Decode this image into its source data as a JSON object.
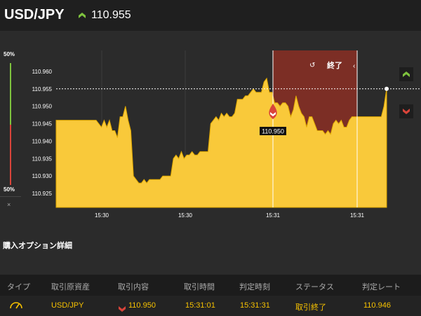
{
  "header": {
    "pair": "USD/JPY",
    "rate": "110.955",
    "rate_direction": "up",
    "up_color": "#7ec23e"
  },
  "sidebar": {
    "top_percent": "50%",
    "bottom_percent": "50%",
    "close_symbol": "×"
  },
  "chart_data": {
    "type": "area",
    "y_ticks": [
      "110.960",
      "110.955",
      "110.950",
      "110.945",
      "110.940",
      "110.935",
      "110.930",
      "110.925"
    ],
    "x_ticks": [
      "15:30",
      "15:30",
      "15:31",
      "15:31"
    ],
    "ylim": [
      110.921,
      110.966
    ],
    "current_rate": 110.955,
    "entry_marker_label": "110.950",
    "expiry_label": "終了",
    "fill_color": "#f9c93a",
    "line_color": "#e0a800",
    "expiry_zone_color": "#8b2f25",
    "values": [
      110.946,
      110.946,
      110.946,
      110.946,
      110.946,
      110.946,
      110.946,
      110.946,
      110.946,
      110.946,
      110.946,
      110.946,
      110.946,
      110.946,
      110.946,
      110.946,
      110.945,
      110.944,
      110.946,
      110.944,
      110.946,
      110.943,
      110.943,
      110.941,
      110.947,
      110.947,
      110.95,
      110.946,
      110.943,
      110.93,
      110.929,
      110.928,
      110.928,
      110.929,
      110.928,
      110.929,
      110.929,
      110.929,
      110.929,
      110.929,
      110.93,
      110.93,
      110.93,
      110.93,
      110.935,
      110.936,
      110.935,
      110.937,
      110.935,
      110.936,
      110.936,
      110.937,
      110.936,
      110.936,
      110.937,
      110.937,
      110.937,
      110.937,
      110.945,
      110.946,
      110.947,
      110.946,
      110.948,
      110.947,
      110.948,
      110.947,
      110.947,
      110.948,
      110.952,
      110.952,
      110.952,
      110.953,
      110.953,
      110.954,
      110.955,
      110.954,
      110.954,
      110.954,
      110.957,
      110.958,
      110.954,
      110.954,
      110.951,
      110.951,
      110.95,
      110.951,
      110.951,
      110.95,
      110.947,
      110.949,
      110.953,
      110.95,
      110.948,
      110.947,
      110.944,
      110.947,
      110.947,
      110.945,
      110.943,
      110.943,
      110.943,
      110.942,
      110.943,
      110.942,
      110.945,
      110.946,
      110.945,
      110.946,
      110.944,
      110.944,
      110.946,
      110.947,
      110.947,
      110.947,
      110.947,
      110.947,
      110.947,
      110.947,
      110.947,
      110.947,
      110.947,
      110.947,
      110.947,
      110.95,
      110.955
    ]
  },
  "details": {
    "title": "購入オプション詳細",
    "columns": [
      "タイプ",
      "取引原資産",
      "取引内容",
      "取引時間",
      "判定時刻",
      "ステータス",
      "判定レート"
    ],
    "row": {
      "type_icon": "gauge-icon",
      "asset": "USD/JPY",
      "content": "110.950",
      "content_direction": "down",
      "trade_time": "15:31:01",
      "judge_time": "15:31:31",
      "status": "取引終了",
      "judge_rate": "110.946"
    },
    "accent_color": "#f7c200",
    "down_color": "#d9443a"
  }
}
